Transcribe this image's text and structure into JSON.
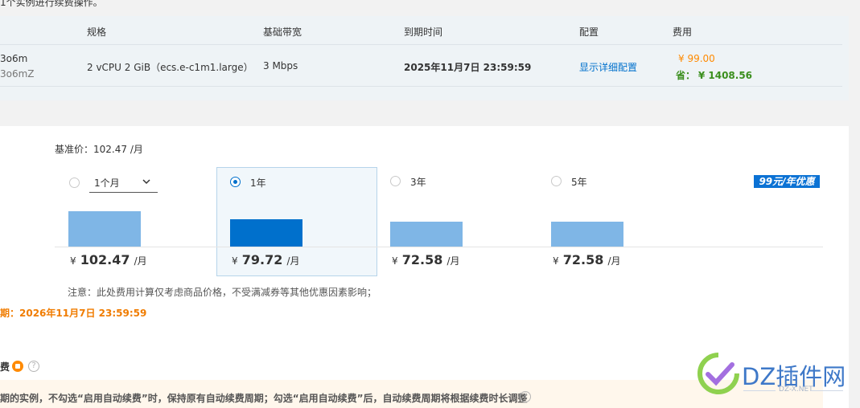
{
  "notice": {
    "text": "1个实例进行续费操作。"
  },
  "table": {
    "headers": [
      "规格",
      "基础带宽",
      "到期时间",
      "配置",
      "费用"
    ],
    "row": {
      "instance_id": "3o6m",
      "instance_name": "3o6mZ",
      "spec": "2 vCPU 2 GiB（ecs.e-c1m1.large）",
      "bandwidth": "3 Mbps",
      "expire": "2025年11月7日 23:59:59",
      "config_link": "显示详细配置",
      "price": "¥ 99.00",
      "save_label": "省：",
      "save_value": "¥ 1408.56"
    }
  },
  "base_price": {
    "label": "基准价：",
    "value": "102.47 /月"
  },
  "options": [
    {
      "label": "1个月",
      "price_symbol": "¥",
      "price": "102.47",
      "unit": "/月",
      "selected": false,
      "relative_value": 1.0
    },
    {
      "label": "1年",
      "price_symbol": "¥",
      "price": "79.72",
      "unit": "/月",
      "selected": true,
      "relative_value": 0.778
    },
    {
      "label": "3年",
      "price_symbol": "¥",
      "price": "72.58",
      "unit": "/月",
      "selected": false,
      "relative_value": 0.708
    },
    {
      "label": "5年",
      "price_symbol": "¥",
      "price": "72.58",
      "unit": "/月",
      "selected": false,
      "relative_value": 0.708
    }
  ],
  "promo_badge": "99元/年优惠",
  "note": "注意：此处费用计算仅考虑商品价格，不受满减券等其他优惠因素影响；",
  "expire_after": "期：2026年11月7日 23:59:59",
  "auto_renew": {
    "title": "费"
  },
  "tip": "期的实例，不勾选“启用自动续费”时，保持原有自动续费周期；勾选“启用自动续费”后，自动续费周期将根据续费时长调整",
  "watermark": {
    "text": "DZ插件网",
    "domain": "DZ-X.NET"
  },
  "colors": {
    "accent": "#0070cc",
    "bar_light": "#7fb6e6",
    "orange": "#ff8a00",
    "green": "#3b8f1e"
  },
  "icons": [
    "chevron-down-icon",
    "coin-icon",
    "help-icon",
    "radio-icon"
  ]
}
